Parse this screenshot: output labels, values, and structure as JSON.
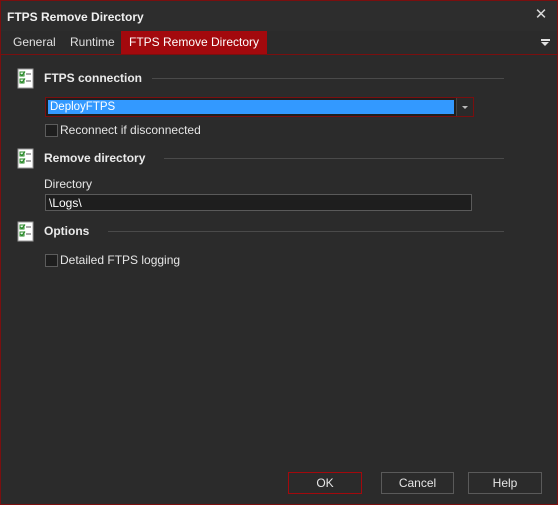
{
  "window": {
    "title": "FTPS Remove Directory"
  },
  "tabs": [
    {
      "label": "General"
    },
    {
      "label": "Runtime"
    },
    {
      "label": "FTPS Remove Directory",
      "active": true
    }
  ],
  "sections": {
    "connection": {
      "header": "FTPS connection",
      "combo_value": "DeployFTPS",
      "reconnect_label": "Reconnect if disconnected",
      "reconnect_checked": false
    },
    "remove": {
      "header": "Remove directory",
      "directory_label": "Directory",
      "directory_value": "\\Logs\\"
    },
    "options": {
      "header": "Options",
      "logging_label": "Detailed FTPS logging",
      "logging_checked": false
    }
  },
  "buttons": {
    "ok": "OK",
    "cancel": "Cancel",
    "help": "Help"
  },
  "colors": {
    "accent": "#a3090d",
    "selection": "#3399ff",
    "background": "#2b2b2b"
  },
  "icons": {
    "section": "checklist-icon",
    "close": "close-icon",
    "menu": "menu-dropdown-icon"
  }
}
